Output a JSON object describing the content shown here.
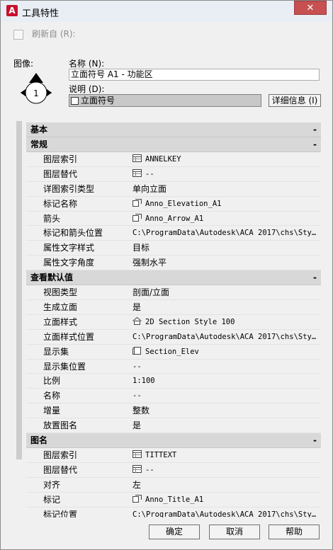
{
  "window": {
    "title": "工具特性",
    "close_glyph": "✕"
  },
  "refresh": {
    "label": "刷新自 (R):"
  },
  "image": {
    "label": "图像:",
    "symbol_number": "1"
  },
  "name": {
    "label": "名称 (N):",
    "value": "立面符号 A1 - 功能区"
  },
  "description": {
    "label": "说明 (D):",
    "value": "立面符号",
    "details_button": "详细信息 (I)"
  },
  "properties": {
    "basic": {
      "label": "基本",
      "toggle": "-"
    },
    "general": {
      "label": "常规",
      "toggle": "-",
      "rows": [
        {
          "key": "图层索引",
          "value": "ANNELKEY",
          "icon": "layer-icon"
        },
        {
          "key": "图层替代",
          "value": "--",
          "icon": "layer-icon"
        },
        {
          "key": "详图索引类型",
          "value": "单向立面",
          "icon": ""
        },
        {
          "key": "标记名称",
          "value": "Anno_Elevation_A1",
          "icon": "block-icon"
        },
        {
          "key": "箭头",
          "value": "Anno_Arrow_A1",
          "icon": "block-icon"
        },
        {
          "key": "标记和箭头位置",
          "value": "C:\\ProgramData\\Autodesk\\ACA  2017\\chs\\Sty…",
          "icon": ""
        },
        {
          "key": "属性文字样式",
          "value": "目标",
          "icon": ""
        },
        {
          "key": "属性文字角度",
          "value": "强制水平",
          "icon": ""
        }
      ]
    },
    "view_defaults": {
      "label": "查看默认值",
      "toggle": "-",
      "rows": [
        {
          "key": "视图类型",
          "value": "剖面/立面",
          "icon": ""
        },
        {
          "key": "生成立面",
          "value": "是",
          "icon": ""
        },
        {
          "key": "立面样式",
          "value": "2D Section Style 100",
          "icon": "house-icon"
        },
        {
          "key": "立面样式位置",
          "value": "C:\\ProgramData\\Autodesk\\ACA  2017\\chs\\Sty…",
          "icon": ""
        },
        {
          "key": "显示集",
          "value": "Section_Elev",
          "icon": "displayset-icon"
        },
        {
          "key": "显示集位置",
          "value": "--",
          "icon": ""
        },
        {
          "key": "比例",
          "value": "1:100",
          "icon": ""
        },
        {
          "key": "名称",
          "value": "--",
          "icon": ""
        },
        {
          "key": "增量",
          "value": "整数",
          "icon": ""
        },
        {
          "key": "放置图名",
          "value": "是",
          "icon": ""
        }
      ]
    },
    "view_title": {
      "label": "图名",
      "toggle": "-",
      "rows": [
        {
          "key": "图层索引",
          "value": "TITTEXT",
          "icon": "layer-icon"
        },
        {
          "key": "图层替代",
          "value": "--",
          "icon": "layer-icon"
        },
        {
          "key": "对齐",
          "value": "左",
          "icon": ""
        },
        {
          "key": "标记",
          "value": "Anno_Title_A1",
          "icon": "block-icon"
        },
        {
          "key": "标记位置",
          "value": "C:\\ProgramData\\Autodesk\\ACA  2017\\chs\\Sty…",
          "icon": ""
        }
      ]
    }
  },
  "buttons": {
    "ok": "确定",
    "cancel": "取消",
    "help": "帮助"
  }
}
